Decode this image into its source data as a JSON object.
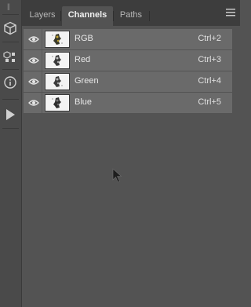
{
  "toolstrip": {
    "grip": "||",
    "icons": [
      "3d-cube-icon",
      "swatches-icon",
      "info-icon",
      "play-icon"
    ]
  },
  "tabs": [
    {
      "label": "Layers",
      "active": false
    },
    {
      "label": "Channels",
      "active": true
    },
    {
      "label": "Paths",
      "active": false
    }
  ],
  "channels": [
    {
      "name": "RGB",
      "shortcut": "Ctrl+2",
      "visible": true
    },
    {
      "name": "Red",
      "shortcut": "Ctrl+3",
      "visible": true
    },
    {
      "name": "Green",
      "shortcut": "Ctrl+4",
      "visible": true
    },
    {
      "name": "Blue",
      "shortcut": "Ctrl+5",
      "visible": true
    }
  ],
  "colors": {
    "panel_bg": "#535353",
    "row_bg": "#6a6a6a",
    "tab_bar": "#3d3d3d"
  }
}
